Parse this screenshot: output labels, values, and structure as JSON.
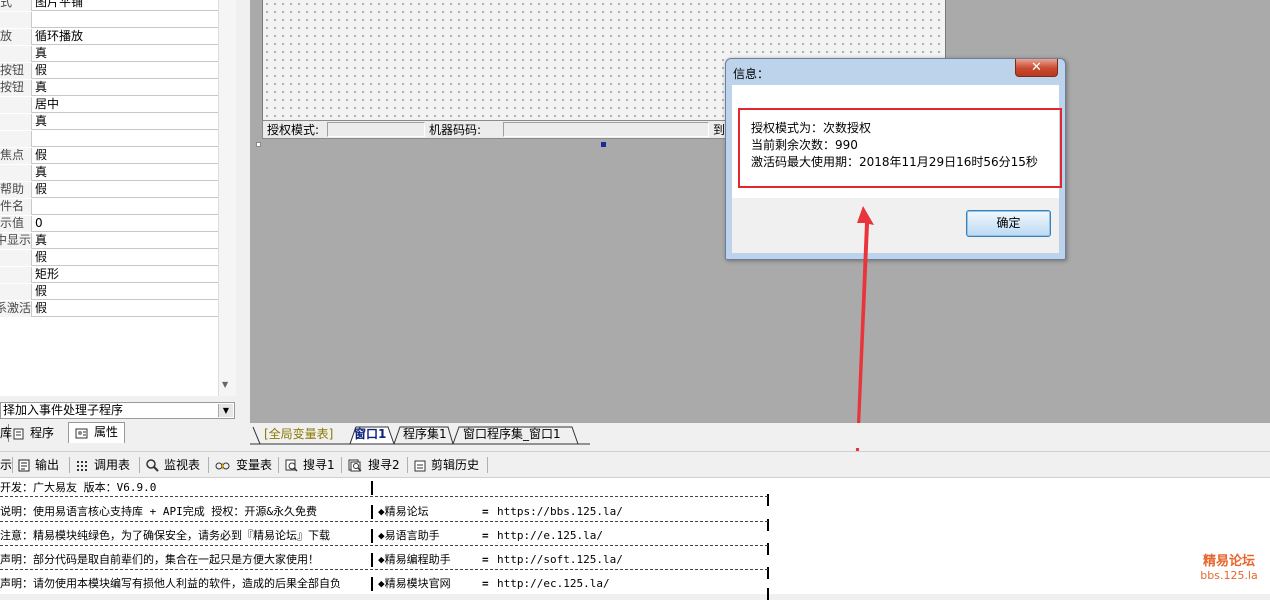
{
  "properties": {
    "rows": [
      {
        "name": "式",
        "value": "图片平铺"
      },
      {
        "name": "",
        "value": ""
      },
      {
        "name": "放",
        "value": "循环播放"
      },
      {
        "name": "",
        "value": "真"
      },
      {
        "name": "按钮",
        "value": "假"
      },
      {
        "name": "按钮",
        "value": "真"
      },
      {
        "name": "",
        "value": "居中"
      },
      {
        "name": "",
        "value": "真"
      },
      {
        "name": "",
        "value": ""
      },
      {
        "name": "焦点",
        "value": "假"
      },
      {
        "name": "",
        "value": "真"
      },
      {
        "name": "帮助",
        "value": "假"
      },
      {
        "name": "件名",
        "value": ""
      },
      {
        "name": "示值",
        "value": "0"
      },
      {
        "name": "中显示",
        "value": "真"
      },
      {
        "name": "",
        "value": "假"
      },
      {
        "name": "",
        "value": "矩形"
      },
      {
        "name": "",
        "value": "假"
      },
      {
        "name": "系激活",
        "value": "假"
      }
    ],
    "event_select": "择加入事件处理子程序",
    "tabs": {
      "support": "库",
      "program": "程序",
      "property": "属性"
    }
  },
  "form": {
    "status_label_1": "授权模式:",
    "status_label_2": "机器码码:",
    "status_label_3": "到"
  },
  "dialog": {
    "title": "信息：",
    "close_glyph": "✕",
    "lines": [
      "授权模式为：次数授权",
      "当前剩余次数：990",
      "激活码最大使用期：2018年11月29日16时56分15秒"
    ],
    "ok_label": "确定"
  },
  "doc_tabs": [
    "[全局变量表]",
    "窗口1",
    "程序集1",
    "窗口程序集_窗口1"
  ],
  "bottom_toolbar": {
    "partial": "示",
    "items": [
      {
        "icon": "output-icon",
        "label": "输出"
      },
      {
        "icon": "call-table-icon",
        "label": "调用表"
      },
      {
        "icon": "search-icon",
        "label": "监视表"
      },
      {
        "icon": "variable-table-icon",
        "label": "变量表"
      },
      {
        "icon": "find1-icon",
        "label": "搜寻1"
      },
      {
        "icon": "find2-icon",
        "label": "搜寻2"
      },
      {
        "icon": "clipboard-history-icon",
        "label": "剪辑历史"
      }
    ]
  },
  "output": {
    "lines": [
      {
        "left": "开发：广大易友    版本：V6.9.0",
        "right_label": "",
        "eq": "",
        "url": ""
      },
      {
        "left": "说明：使用易语言核心支持库 + API完成       授权：开源&永久免费",
        "right_label": "◆精易论坛",
        "eq": "=",
        "url": "https://bbs.125.la/"
      },
      {
        "left": "注意：精易模块纯绿色，为了确保安全，请务必到『精易论坛』下载",
        "right_label": "◆易语言助手",
        "eq": "=",
        "url": "http://e.125.la/"
      },
      {
        "left": "声明：部分代码是取自前辈们的，集合在一起只是方便大家使用！",
        "right_label": "◆精易编程助手",
        "eq": "=",
        "url": "http://soft.125.la/"
      },
      {
        "left": "声明：请勿使用本模块编写有损他人利益的软件，造成的后果全部自负",
        "right_label": "◆精易模块官网",
        "eq": "=",
        "url": "http://ec.125.la/"
      }
    ]
  },
  "watermark": {
    "line1": "精易论坛",
    "line2": "bbs.125.la"
  },
  "colors": {
    "highlight": "#e0282e",
    "arrow": "#e8343a",
    "designer_bg": "#aaaaab",
    "watermark": "#e8662e"
  }
}
